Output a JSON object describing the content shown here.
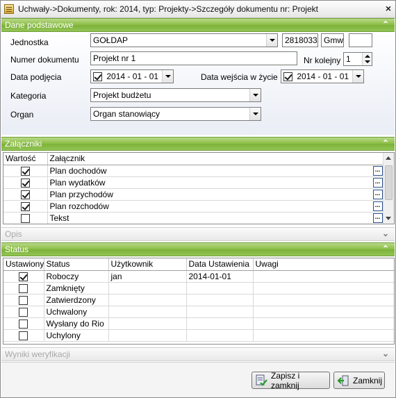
{
  "window": {
    "title": "Uchwały->Dokumenty, rok: 2014, typ: Projekty->Szczegóły dokumentu nr: Projekt",
    "close_glyph": "×"
  },
  "icons": {
    "expanded": "⌃",
    "collapsed": "⌄",
    "ellipsis": "..."
  },
  "sections": {
    "dane": "Dane podstawowe",
    "zalaczniki": "Załączniki",
    "opis": "Opis",
    "status": "Status",
    "wyniki": "Wyniki weryfikacji"
  },
  "form": {
    "jednostka_label": "Jednostka",
    "jednostka_value": "GOŁDAP",
    "jednostka_code": "2818033",
    "jednostka_type": "Gmw",
    "jednostka_extra": "",
    "numer_label": "Numer dokumentu",
    "numer_value": "Projekt nr 1",
    "nr_kolejny_label": "Nr kolejny",
    "nr_kolejny_value": "1",
    "data_podjecia_label": "Data podjęcia",
    "data_podjecia_value": "2014 - 01 - 01",
    "data_wejscia_label": "Data wejścia w życie",
    "data_wejscia_value": "2014 - 01 - 01",
    "kategoria_label": "Kategoria",
    "kategoria_value": "Projekt budżetu",
    "organ_label": "Organ",
    "organ_value": "Organ stanowiący"
  },
  "attachments": {
    "columns": [
      "Wartość",
      "Załącznik"
    ],
    "rows": [
      {
        "checked": true,
        "name": "Plan dochodów"
      },
      {
        "checked": true,
        "name": "Plan wydatków"
      },
      {
        "checked": true,
        "name": "Plan przychodów"
      },
      {
        "checked": true,
        "name": "Plan rozchodów"
      },
      {
        "checked": false,
        "name": "Tekst"
      }
    ]
  },
  "status_table": {
    "columns": [
      "Ustawiony",
      "Status",
      "Użytkownik",
      "Data Ustawienia",
      "Uwagi"
    ],
    "rows": [
      {
        "checked": true,
        "status": "Roboczy",
        "user": "jan",
        "date": "2014-01-01",
        "notes": ""
      },
      {
        "checked": false,
        "status": "Zamknięty",
        "user": "",
        "date": "",
        "notes": ""
      },
      {
        "checked": false,
        "status": "Zatwierdzony",
        "user": "",
        "date": "",
        "notes": ""
      },
      {
        "checked": false,
        "status": "Uchwalony",
        "user": "",
        "date": "",
        "notes": ""
      },
      {
        "checked": false,
        "status": "Wysłany do Rio",
        "user": "",
        "date": "",
        "notes": ""
      },
      {
        "checked": false,
        "status": "Uchylony",
        "user": "",
        "date": "",
        "notes": ""
      }
    ]
  },
  "buttons": {
    "save_close": "Zapisz i zamknij",
    "close": "Zamknij"
  }
}
